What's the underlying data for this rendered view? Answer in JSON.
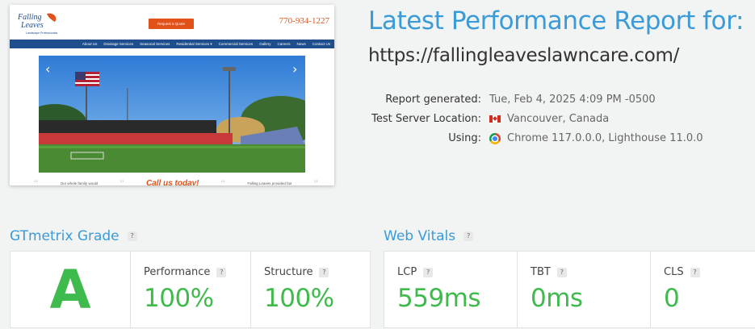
{
  "thumbnail": {
    "logo_line1": "Falling",
    "logo_line2": "Leaves",
    "logo_sub": "Landscape Professionals",
    "request_button": "Request a Quote",
    "phone": "770-934-1227",
    "nav": [
      "About Us",
      "Drainage Services",
      "Seasonal Services",
      "Residential Services ▾",
      "Commercial Services",
      "Gallery",
      "Careers",
      "News",
      "Contact Us"
    ],
    "quote_left": "Our whole family would",
    "cta": "Call us today!",
    "quote_right": "Falling Leaves provided fair",
    "open_quote": "“",
    "close_quote": "”",
    "arrow_left": "‹",
    "arrow_right": "›"
  },
  "report": {
    "title": "Latest Performance Report for:",
    "url": "https://fallingleaveslawncare.com/",
    "generated_label": "Report generated:",
    "generated_value": "Tue, Feb 4, 2025 4:09 PM -0500",
    "location_label": "Test Server Location:",
    "location_value": "Vancouver, Canada",
    "using_label": "Using:",
    "using_value": "Chrome 117.0.0.0, Lighthouse 11.0.0",
    "flag_icon": "canada-flag-icon",
    "browser_icon": "chrome-icon"
  },
  "gtmetrix": {
    "title": "GTmetrix Grade",
    "help": "?",
    "grade": "A",
    "performance_label": "Performance",
    "performance_value": "100%",
    "structure_label": "Structure",
    "structure_value": "100%"
  },
  "web_vitals": {
    "title": "Web Vitals",
    "help": "?",
    "lcp_label": "LCP",
    "lcp_value": "559ms",
    "tbt_label": "TBT",
    "tbt_value": "0ms",
    "cls_label": "CLS",
    "cls_value": "0"
  },
  "colors": {
    "accent_blue": "#3a9bd8",
    "grade_green": "#3fba4c",
    "site_orange": "#e0521a",
    "site_nav_blue": "#1f4e8c"
  }
}
